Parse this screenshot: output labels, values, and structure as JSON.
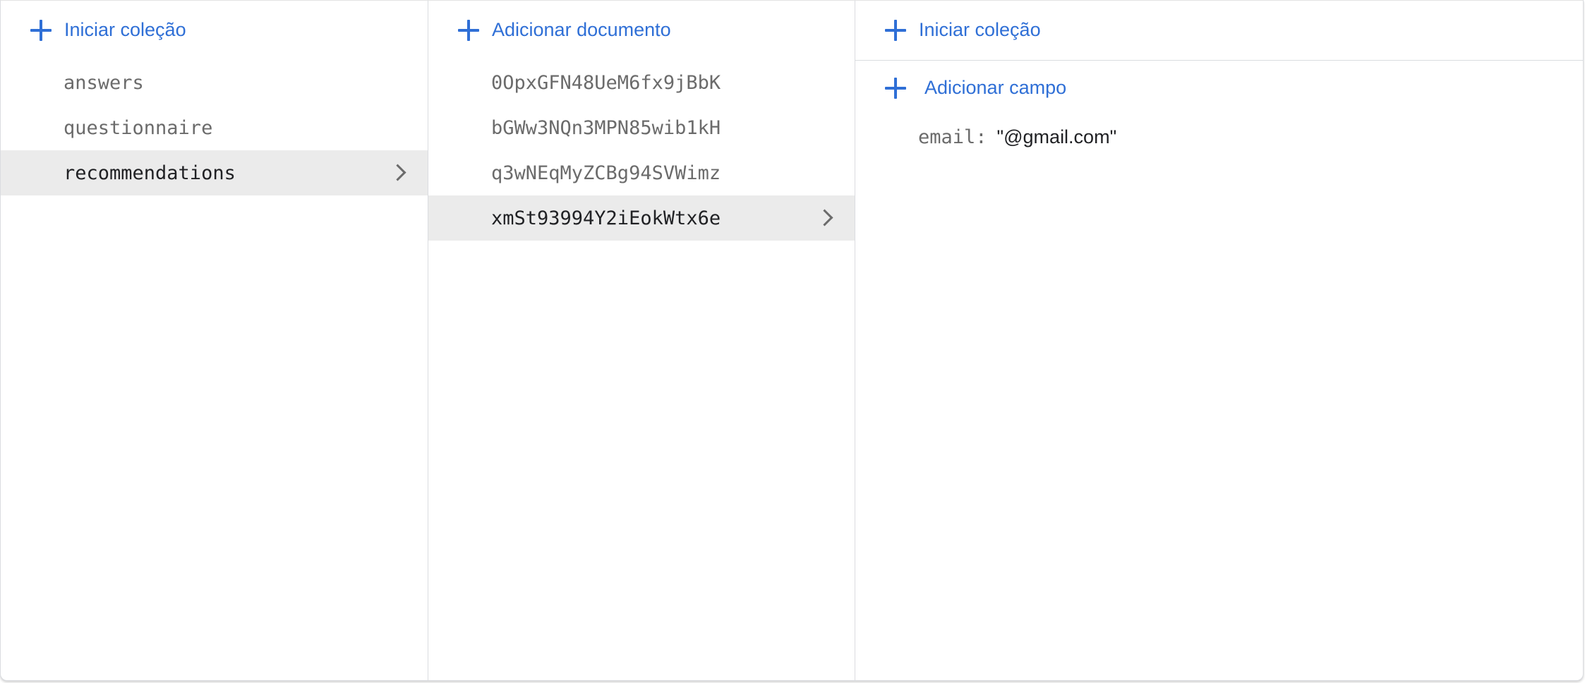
{
  "collections_panel": {
    "action_label": "Iniciar coleção",
    "items": [
      {
        "label": "answers",
        "selected": false
      },
      {
        "label": "questionnaire",
        "selected": false
      },
      {
        "label": "recommendations",
        "selected": true
      }
    ]
  },
  "documents_panel": {
    "action_label": "Adicionar documento",
    "items": [
      {
        "label": "0OpxGFN48UeM6fx9jBbK",
        "selected": false
      },
      {
        "label": "bGWw3NQn3MPN85wib1kH",
        "selected": false
      },
      {
        "label": "q3wNEqMyZCBg94SVWimz",
        "selected": false
      },
      {
        "label": "xmSt93994Y2iEokWtx6e",
        "selected": true
      }
    ]
  },
  "fields_panel": {
    "start_collection_label": "Iniciar coleção",
    "add_field_label": "Adicionar campo",
    "fields": [
      {
        "key": "email",
        "separator": ":",
        "value": "\"@gmail.com\""
      }
    ]
  },
  "icons": {
    "add": "plus-icon",
    "open": "chevron-right-icon"
  },
  "colors": {
    "accent": "#2f6fd6",
    "selected_background": "#ebebeb",
    "muted_text": "#6b6b6b",
    "divider": "#dadce0"
  }
}
